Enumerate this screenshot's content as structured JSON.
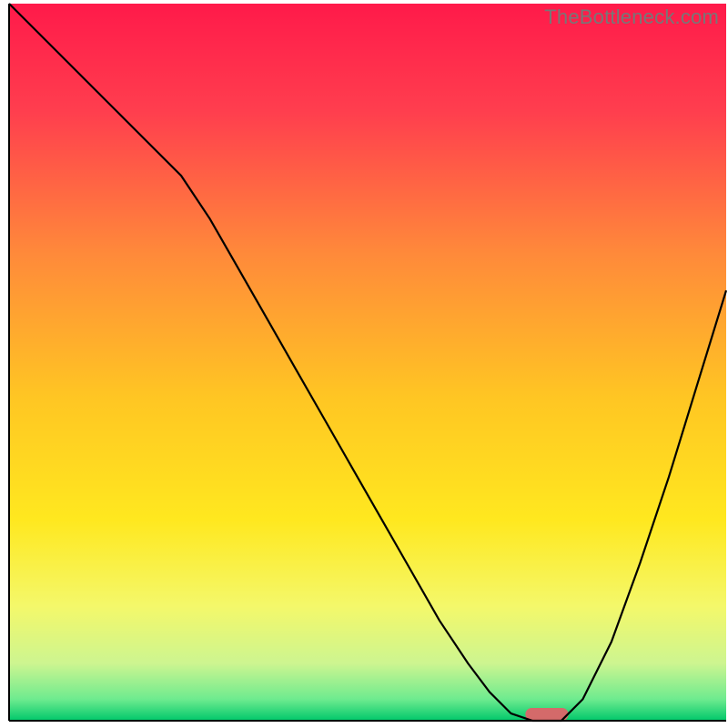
{
  "watermark": "TheBottleneck.com",
  "chart_data": {
    "type": "line",
    "title": "",
    "xlabel": "",
    "ylabel": "",
    "xlim": [
      0,
      100
    ],
    "ylim": [
      0,
      100
    ],
    "grid": false,
    "x": [
      0,
      4,
      8,
      12,
      16,
      20,
      24,
      28,
      32,
      36,
      40,
      44,
      48,
      52,
      56,
      60,
      64,
      67,
      70,
      73,
      77,
      80,
      84,
      88,
      92,
      96,
      100
    ],
    "values": [
      100,
      96,
      92,
      88,
      84,
      80,
      76,
      70,
      63,
      56,
      49,
      42,
      35,
      28,
      21,
      14,
      8,
      4,
      1,
      0,
      0,
      3,
      11,
      22,
      34,
      47,
      60
    ],
    "background": {
      "type": "vertical_gradient",
      "stops": [
        {
          "offset": 0.0,
          "color": "#ff1a4a"
        },
        {
          "offset": 0.15,
          "color": "#ff3e4e"
        },
        {
          "offset": 0.35,
          "color": "#ff8a3a"
        },
        {
          "offset": 0.55,
          "color": "#ffc623"
        },
        {
          "offset": 0.72,
          "color": "#ffe81f"
        },
        {
          "offset": 0.84,
          "color": "#f4f86a"
        },
        {
          "offset": 0.92,
          "color": "#cdf590"
        },
        {
          "offset": 0.97,
          "color": "#6eeb8f"
        },
        {
          "offset": 1.0,
          "color": "#00c86b"
        }
      ]
    },
    "marker": {
      "x_center": 75,
      "y": 0,
      "width": 6,
      "color": "#d46a6a"
    },
    "axes": {
      "left": true,
      "bottom": true,
      "color": "#000000",
      "width": 2
    }
  }
}
